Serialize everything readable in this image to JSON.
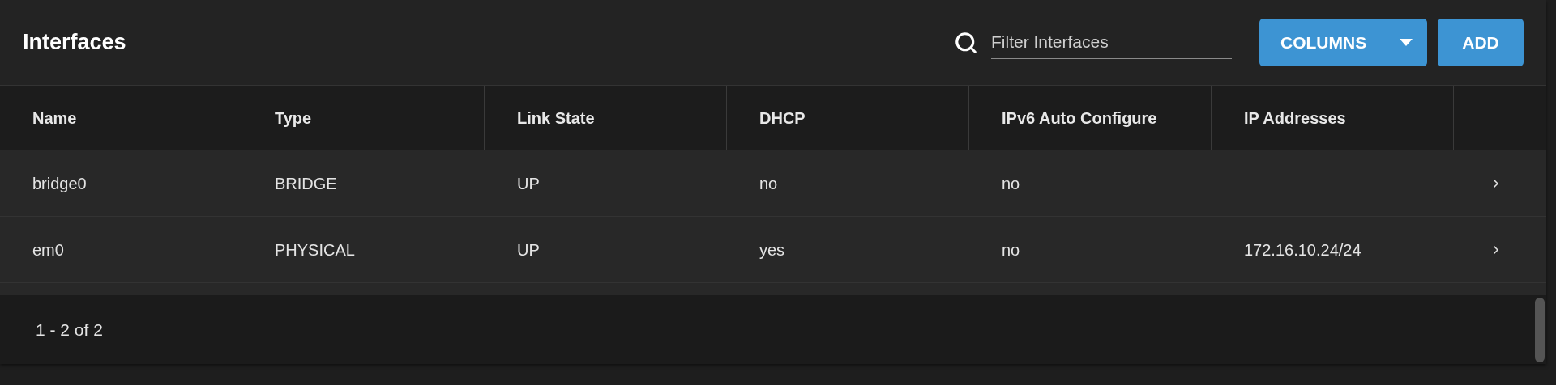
{
  "title": "Interfaces",
  "search": {
    "placeholder": "Filter Interfaces"
  },
  "buttons": [
    {
      "label": "COLUMNS",
      "kind": "dropdown"
    },
    {
      "label": "ADD",
      "kind": "plain"
    }
  ],
  "table": {
    "columns": [
      "Name",
      "Type",
      "Link State",
      "DHCP",
      "IPv6 Auto Configure",
      "IP Addresses"
    ],
    "rows": [
      {
        "cells": [
          "bridge0",
          "BRIDGE",
          "UP",
          "no",
          "no",
          ""
        ]
      },
      {
        "cells": [
          "em0",
          "PHYSICAL",
          "UP",
          "yes",
          "no",
          "172.16.10.24/24"
        ]
      }
    ]
  },
  "footer": {
    "range": "1 - 2 of 2"
  }
}
